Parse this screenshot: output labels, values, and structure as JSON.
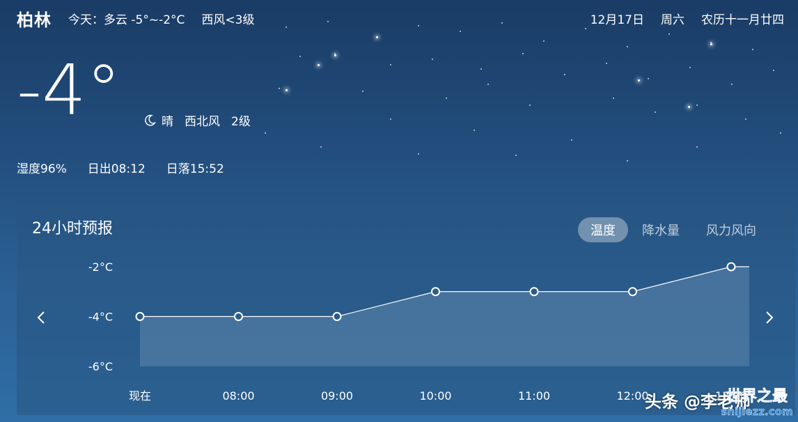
{
  "header": {
    "city": "柏林",
    "today_forecast": "今天：多云 -5°~-2°C",
    "today_wind": "西风<3级",
    "date": "12月17日",
    "weekday": "周六",
    "lunar": "农历十一月廿四"
  },
  "current": {
    "temp": "-4°",
    "icon": "moon-icon",
    "condition": "晴",
    "wind_dir": "西北风",
    "wind_level": "2级",
    "humidity": "湿度96%",
    "sunrise": "日出08:12",
    "sunset": "日落15:52"
  },
  "forecast_panel": {
    "title": "24小时预报",
    "tabs": [
      "温度",
      "降水量",
      "风力风向"
    ],
    "active_tab": 0
  },
  "chart_data": {
    "type": "area",
    "x": [
      "现在",
      "08:00",
      "09:00",
      "10:00",
      "11:00",
      "12:00",
      "13:00"
    ],
    "y_tick_labels": [
      "-2°C",
      "-4°C",
      "-6°C"
    ],
    "values": [
      -4,
      -4,
      -4,
      -3,
      -3,
      -3,
      -2
    ],
    "ylim": [
      -6,
      -2
    ],
    "grid": false,
    "line_color": "#ffffff",
    "fill_color": "#5f86ad"
  },
  "watermark": {
    "text1": "头条",
    "text2": "@李",
    "text3": "老师",
    "logo_text": "世界之最",
    "logo_url_text": "shijiezz.com"
  },
  "colors": {
    "bg_top": "#1a3c66",
    "bg_bottom": "#2f6ea6",
    "tab_active_bg": "rgba(255,255,255,0.35)"
  }
}
